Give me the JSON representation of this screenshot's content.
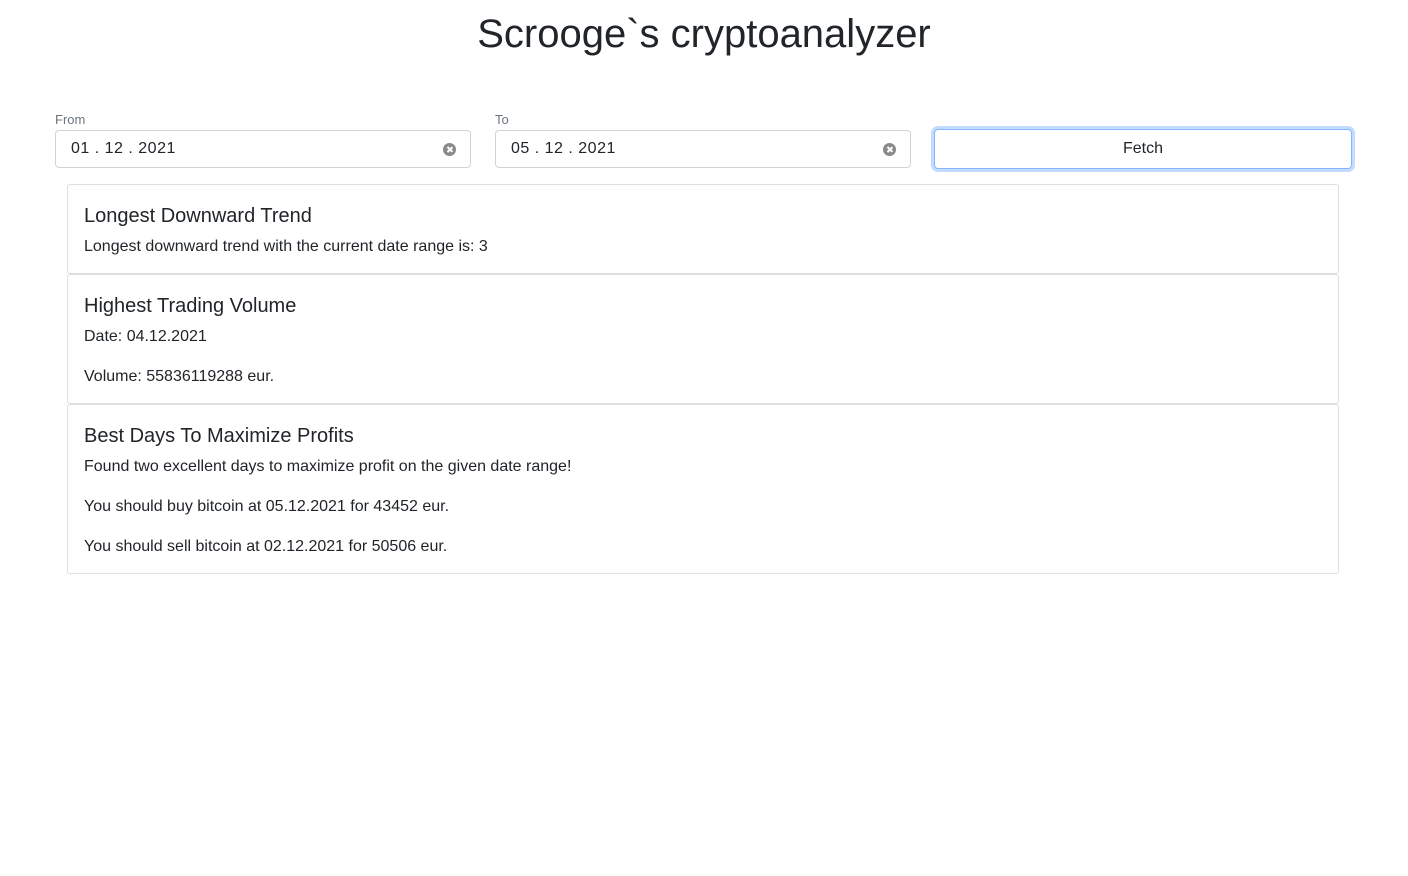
{
  "header": {
    "title": "Scrooge`s cryptoanalyzer"
  },
  "filters": {
    "from": {
      "label": "From",
      "value": "01 . 12 . 2021"
    },
    "to": {
      "label": "To",
      "value": "05 . 12 . 2021"
    },
    "fetch_label": "Fetch"
  },
  "cards": {
    "trend": {
      "title": "Longest Downward Trend",
      "text": "Longest downward trend with the current date range is: 3"
    },
    "volume": {
      "title": "Highest Trading Volume",
      "date_text": "Date: 04.12.2021",
      "volume_text": "Volume: 55836119288 eur."
    },
    "profits": {
      "title": "Best Days To Maximize Profits",
      "intro": "Found two excellent days to maximize profit on the given date range!",
      "buy": "You should buy bitcoin at 05.12.2021 for 43452 eur.",
      "sell": "You should sell bitcoin at 02.12.2021 for 50506 eur."
    }
  },
  "colors": {
    "focus_border": "#86b7fe",
    "text": "#212529",
    "muted": "#6c757d"
  },
  "icons": {
    "clear": "clear-circle-icon"
  }
}
